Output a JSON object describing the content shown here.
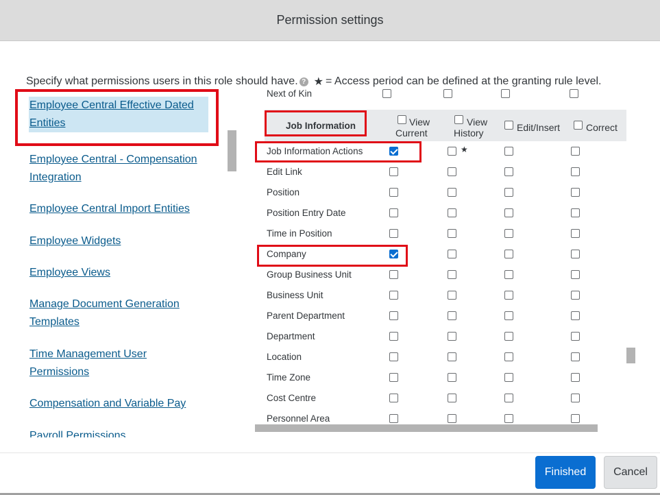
{
  "dialog": {
    "title": "Permission settings"
  },
  "instructions": {
    "text": "Specify what permissions users in this role should have.",
    "help_icon": "question-icon",
    "star": "★",
    "legend": "= Access period can be defined at the granting rule level."
  },
  "left_nav": {
    "items": [
      {
        "label_line1": "Employee Central Effective Dated",
        "label_line2": "Entities",
        "selected": true
      },
      {
        "label_line1": "Employee Central - Compensation",
        "label_line2": "Integration"
      },
      {
        "label_line1": "Employee Central Import Entities"
      },
      {
        "label_line1": "Employee Widgets"
      },
      {
        "label_line1": "Employee Views"
      },
      {
        "label_line1": "Manage Document Generation",
        "label_line2": "Templates"
      },
      {
        "label_line1": "Time Management User",
        "label_line2": "Permissions"
      },
      {
        "label_line1": "Compensation and Variable Pay"
      },
      {
        "label_line1": "Payroll Permissions"
      }
    ]
  },
  "table": {
    "previous_row_label": "Next of Kin",
    "group_title": "Job Information",
    "columns": {
      "view_current_1": "View",
      "view_current_2": "Current",
      "view_history_1": "View",
      "view_history_2": "History",
      "edit_insert": "Edit/Insert",
      "correct": "Correct"
    },
    "rows": [
      {
        "label": "Job Information Actions",
        "view_current": true,
        "view_history": false,
        "history_star": "★",
        "edit_insert": false,
        "correct": false
      },
      {
        "label": "Edit Link",
        "view_current": false,
        "view_history": false,
        "edit_insert": false,
        "correct": false
      },
      {
        "label": "Position",
        "view_current": false,
        "view_history": false,
        "edit_insert": false,
        "correct": false
      },
      {
        "label": "Position Entry Date",
        "view_current": false,
        "view_history": false,
        "edit_insert": false,
        "correct": false
      },
      {
        "label": "Time in Position",
        "view_current": false,
        "view_history": false,
        "edit_insert": false,
        "correct": false
      },
      {
        "label": "Company",
        "view_current": true,
        "view_history": false,
        "edit_insert": false,
        "correct": false
      },
      {
        "label": "Group Business Unit",
        "view_current": false,
        "view_history": false,
        "edit_insert": false,
        "correct": false
      },
      {
        "label": "Business Unit",
        "view_current": false,
        "view_history": false,
        "edit_insert": false,
        "correct": false
      },
      {
        "label": "Parent Department",
        "view_current": false,
        "view_history": false,
        "edit_insert": false,
        "correct": false
      },
      {
        "label": "Department",
        "view_current": false,
        "view_history": false,
        "edit_insert": false,
        "correct": false
      },
      {
        "label": "Location",
        "view_current": false,
        "view_history": false,
        "edit_insert": false,
        "correct": false
      },
      {
        "label": "Time Zone",
        "view_current": false,
        "view_history": false,
        "edit_insert": false,
        "correct": false
      },
      {
        "label": "Cost Centre",
        "view_current": false,
        "view_history": false,
        "edit_insert": false,
        "correct": false
      },
      {
        "label": "Personnel Area",
        "view_current": false,
        "view_history": false,
        "edit_insert": false,
        "correct": false
      }
    ]
  },
  "footer": {
    "finished_label": "Finished",
    "cancel_label": "Cancel"
  },
  "colors": {
    "accent": "#0a6ed1",
    "highlight_box": "#e00c17",
    "link": "#0a5b8c",
    "selected_bg": "#cde6f3"
  }
}
